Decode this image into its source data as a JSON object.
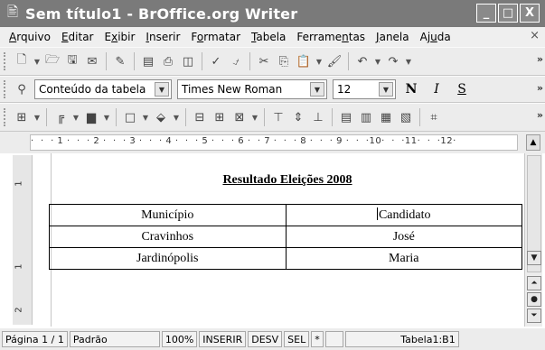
{
  "window": {
    "title": "Sem título1 - BrOffice.org Writer",
    "app_icon": "writer-app-icon"
  },
  "window_buttons": [
    "_",
    "□",
    "X"
  ],
  "menu": {
    "items": [
      {
        "pre": "",
        "u": "A",
        "post": "rquivo"
      },
      {
        "pre": "",
        "u": "E",
        "post": "ditar"
      },
      {
        "pre": "E",
        "u": "x",
        "post": "ibir"
      },
      {
        "pre": "",
        "u": "I",
        "post": "nserir"
      },
      {
        "pre": "F",
        "u": "o",
        "post": "rmatar"
      },
      {
        "pre": "",
        "u": "T",
        "post": "abela"
      },
      {
        "pre": "Ferrame",
        "u": "n",
        "post": "tas"
      },
      {
        "pre": "",
        "u": "J",
        "post": "anela"
      },
      {
        "pre": "Aj",
        "u": "u",
        "post": "da"
      }
    ],
    "close": "×"
  },
  "formatting": {
    "style": "Conteúdo da tabela",
    "font": "Times New Roman",
    "size": "12",
    "bold": "N",
    "italic": "I",
    "underline": "S"
  },
  "ruler_ticks": "·  ·  · 1 ·  ·  · 2 ·  ·  · 3 ·  ·  · 4 ·  ·  · 5 ·  ·  · 6 ·  · 7 ·  ·  · 8 ·  ·  · 9 ·  ·  ·10·  ·  ·11·  ·  ·12·",
  "vruler_marks": [
    "1",
    "1",
    "2"
  ],
  "document": {
    "heading": "Resultado Eleições 2008",
    "table": [
      [
        "Município",
        "Candidato"
      ],
      [
        "Cravinhos",
        "José"
      ],
      [
        "Jardinópolis",
        "Maria"
      ]
    ]
  },
  "status": {
    "page": "Página 1 / 1",
    "style": "Padrão",
    "zoom": "100%",
    "insert": "INSERIR",
    "desv": "DESV",
    "sel": "SEL",
    "modified": "*",
    "cell": "Tabela1:B1"
  }
}
